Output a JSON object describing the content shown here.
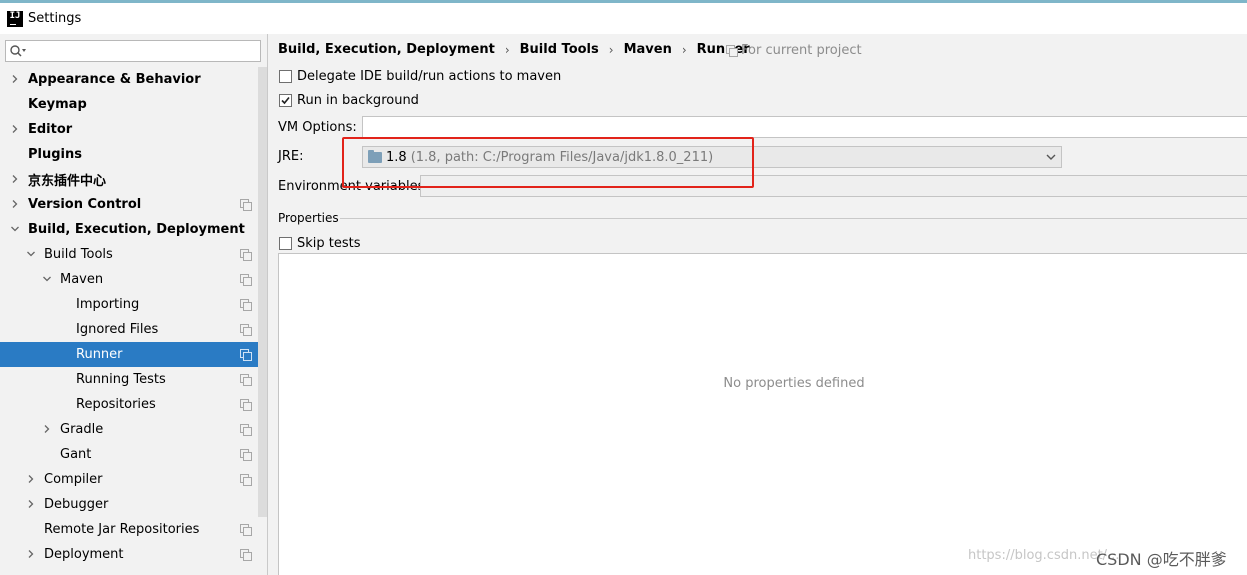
{
  "window": {
    "title": "Settings",
    "app_icon": "IJ"
  },
  "sidebar": {
    "search": {
      "value": "",
      "icon": "search-icon"
    },
    "items": [
      {
        "label": "Appearance & Behavior",
        "bold": true,
        "expand": "collapsed",
        "level": 0,
        "copy_icon": false,
        "selected": false
      },
      {
        "label": "Keymap",
        "bold": true,
        "expand": "none",
        "level": 0,
        "copy_icon": false,
        "selected": false
      },
      {
        "label": "Editor",
        "bold": true,
        "expand": "collapsed",
        "level": 0,
        "copy_icon": false,
        "selected": false
      },
      {
        "label": "Plugins",
        "bold": true,
        "expand": "none",
        "level": 0,
        "copy_icon": false,
        "selected": false
      },
      {
        "label": "京东插件中心",
        "bold": true,
        "expand": "collapsed",
        "level": 0,
        "copy_icon": false,
        "selected": false
      },
      {
        "label": "Version Control",
        "bold": true,
        "expand": "collapsed",
        "level": 0,
        "copy_icon": true,
        "selected": false
      },
      {
        "label": "Build, Execution, Deployment",
        "bold": true,
        "expand": "expanded",
        "level": 0,
        "copy_icon": false,
        "selected": false
      },
      {
        "label": "Build Tools",
        "bold": false,
        "expand": "expanded",
        "level": 1,
        "copy_icon": true,
        "selected": false
      },
      {
        "label": "Maven",
        "bold": false,
        "expand": "expanded",
        "level": 2,
        "copy_icon": true,
        "selected": false
      },
      {
        "label": "Importing",
        "bold": false,
        "expand": "none",
        "level": 3,
        "copy_icon": true,
        "selected": false
      },
      {
        "label": "Ignored Files",
        "bold": false,
        "expand": "none",
        "level": 3,
        "copy_icon": true,
        "selected": false
      },
      {
        "label": "Runner",
        "bold": false,
        "expand": "none",
        "level": 3,
        "copy_icon": true,
        "selected": true
      },
      {
        "label": "Running Tests",
        "bold": false,
        "expand": "none",
        "level": 3,
        "copy_icon": true,
        "selected": false
      },
      {
        "label": "Repositories",
        "bold": false,
        "expand": "none",
        "level": 3,
        "copy_icon": true,
        "selected": false
      },
      {
        "label": "Gradle",
        "bold": false,
        "expand": "collapsed",
        "level": 2,
        "copy_icon": true,
        "selected": false
      },
      {
        "label": "Gant",
        "bold": false,
        "expand": "none",
        "level": 2,
        "copy_icon": true,
        "selected": false
      },
      {
        "label": "Compiler",
        "bold": false,
        "expand": "collapsed",
        "level": 1,
        "copy_icon": true,
        "selected": false
      },
      {
        "label": "Debugger",
        "bold": false,
        "expand": "collapsed",
        "level": 1,
        "copy_icon": false,
        "selected": false
      },
      {
        "label": "Remote Jar Repositories",
        "bold": false,
        "expand": "none",
        "level": 1,
        "copy_icon": true,
        "selected": false
      },
      {
        "label": "Deployment",
        "bold": false,
        "expand": "collapsed",
        "level": 1,
        "copy_icon": true,
        "selected": false
      }
    ]
  },
  "main": {
    "breadcrumb": [
      "Build, Execution, Deployment",
      "Build Tools",
      "Maven",
      "Runner"
    ],
    "breadcrumb_sep": "›",
    "for_current_project": "For current project",
    "delegate_checkbox": {
      "label": "Delegate IDE build/run actions to maven",
      "checked": false
    },
    "background_checkbox": {
      "label": "Run in background",
      "checked": true
    },
    "vm_options": {
      "label": "VM Options:",
      "value": ""
    },
    "jre": {
      "label": "JRE:",
      "value": "1.8",
      "detail": "(1.8, path: C:/Program Files/Java/jdk1.8.0_211)"
    },
    "env_vars": {
      "label": "Environment variables:",
      "value": ""
    },
    "properties": {
      "section_title": "Properties",
      "skip_tests": {
        "label": "Skip tests",
        "checked": false
      },
      "empty_text": "No properties defined"
    }
  },
  "watermark": {
    "url": "https://blog.csdn.net/...",
    "brand": "CSDN @吃不胖爹"
  },
  "colors": {
    "selection": "#2a7bc4",
    "highlight_box": "#e2231a",
    "background": "#f2f2f2"
  }
}
